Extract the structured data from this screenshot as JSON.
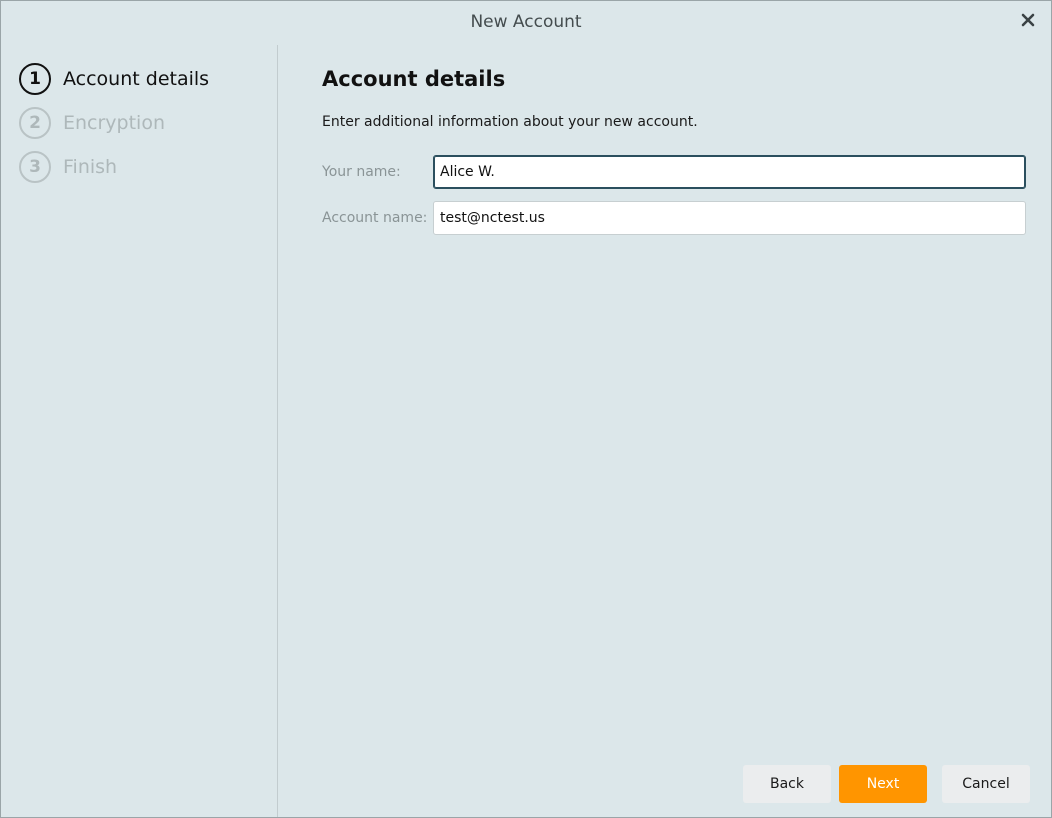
{
  "window": {
    "title": "New Account",
    "close_icon": "close-icon"
  },
  "steps": [
    {
      "number": "1",
      "label": "Account details",
      "state": "active"
    },
    {
      "number": "2",
      "label": "Encryption",
      "state": "inactive"
    },
    {
      "number": "3",
      "label": "Finish",
      "state": "inactive"
    }
  ],
  "main": {
    "heading": "Account details",
    "description": "Enter additional information about your new account.",
    "fields": [
      {
        "label": "Your name:",
        "value": "Alice W."
      },
      {
        "label": "Account name:",
        "value": "test@nctest.us"
      }
    ]
  },
  "buttons": {
    "back": "Back",
    "next": "Next",
    "cancel": "Cancel"
  },
  "colors": {
    "background": "#dce7ea",
    "accent": "#ff9500",
    "focus_border": "#2b4f5e"
  }
}
